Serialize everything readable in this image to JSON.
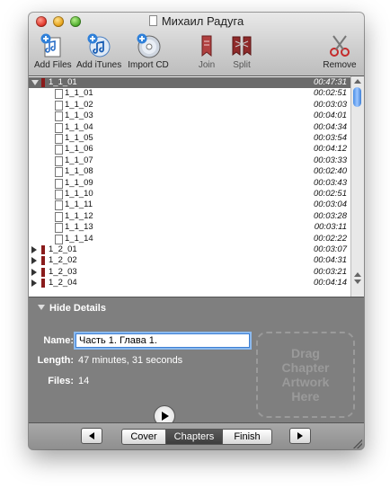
{
  "window": {
    "title": "Михаил Радуга"
  },
  "toolbar": {
    "add_files": "Add Files",
    "add_itunes": "Add iTunes",
    "import_cd": "Import CD",
    "join": "Join",
    "split": "Split",
    "remove": "Remove"
  },
  "list": {
    "rows": [
      {
        "name": "1_1_01",
        "duration": "00:47:31",
        "level": 0,
        "expanded": true,
        "selected": true
      },
      {
        "name": "1_1_01",
        "duration": "00:02:51",
        "level": 1
      },
      {
        "name": "1_1_02",
        "duration": "00:03:03",
        "level": 1
      },
      {
        "name": "1_1_03",
        "duration": "00:04:01",
        "level": 1
      },
      {
        "name": "1_1_04",
        "duration": "00:04:34",
        "level": 1
      },
      {
        "name": "1_1_05",
        "duration": "00:03:54",
        "level": 1
      },
      {
        "name": "1_1_06",
        "duration": "00:04:12",
        "level": 1
      },
      {
        "name": "1_1_07",
        "duration": "00:03:33",
        "level": 1
      },
      {
        "name": "1_1_08",
        "duration": "00:02:40",
        "level": 1
      },
      {
        "name": "1_1_09",
        "duration": "00:03:43",
        "level": 1
      },
      {
        "name": "1_1_10",
        "duration": "00:02:51",
        "level": 1
      },
      {
        "name": "1_1_11",
        "duration": "00:03:04",
        "level": 1
      },
      {
        "name": "1_1_12",
        "duration": "00:03:28",
        "level": 1
      },
      {
        "name": "1_1_13",
        "duration": "00:03:11",
        "level": 1
      },
      {
        "name": "1_1_14",
        "duration": "00:02:22",
        "level": 1
      },
      {
        "name": "1_2_01",
        "duration": "00:03:07",
        "level": 0
      },
      {
        "name": "1_2_02",
        "duration": "00:04:31",
        "level": 0
      },
      {
        "name": "1_2_03",
        "duration": "00:03:21",
        "level": 0
      },
      {
        "name": "1_2_04",
        "duration": "00:04:14",
        "level": 0
      }
    ]
  },
  "details": {
    "toggle_label": "Hide Details",
    "name_label": "Name:",
    "name_value": "Часть 1. Глава 1.",
    "length_label": "Length:",
    "length_value": "47 minutes, 31 seconds",
    "files_label": "Files:",
    "files_value": "14",
    "artwork_lines": [
      "Drag",
      "Chapter",
      "Artwork",
      "Here"
    ]
  },
  "bottombar": {
    "tabs": [
      "Cover",
      "Chapters",
      "Finish"
    ],
    "active_tab": "Chapters"
  },
  "colors": {
    "selection": "#6b6b6b",
    "focus_ring": "#3c7fd4",
    "book_icon": "#8a1b1b"
  }
}
